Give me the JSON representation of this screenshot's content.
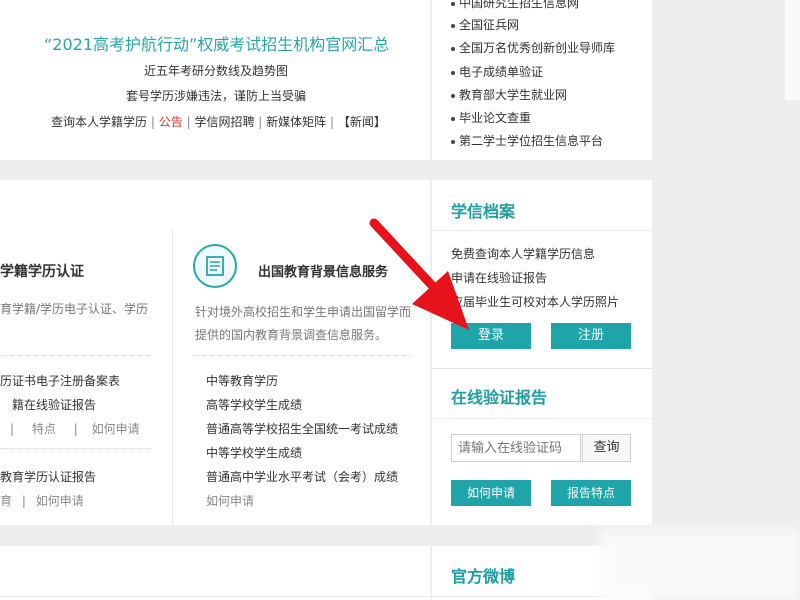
{
  "top": {
    "banner": "“2021高考护航行动”权威考试招生机构官网汇总",
    "line2": "近五年考研分数线及趋势图",
    "line3": "套号学历涉嫌违法，谨防上当受骗",
    "links": {
      "l1": "查询本人学籍学历",
      "sep": "|",
      "l2": "公告",
      "l3": "学信网招聘",
      "l4": "新媒体矩阵",
      "l5": "【新闻】"
    }
  },
  "right_list": [
    "中国研究生招生信息网",
    "全国征兵网",
    "全国万名优秀创新创业导师库",
    "电子成绩单验证",
    "教育部大学生就业网",
    "毕业论文查重",
    "第二学士学位招生信息平台"
  ],
  "card_left": {
    "title": "学籍学历认证",
    "desc": "育学籍/学历电子认证、学历",
    "item1": "历证书电子注册备案表",
    "item2": "籍在线验证报告",
    "sub1": {
      "a": "|",
      "b": "特点",
      "c": "|",
      "d": "如何申请"
    },
    "item3": "教育学历认证报告",
    "sub2": {
      "a": "育",
      "b": "|",
      "c": "如何申请"
    }
  },
  "card_mid": {
    "title": "出国教育背景信息服务",
    "desc1": "针对境外高校招生和学生申请出国留学而",
    "desc2": "提供的国内教育背景调查信息服务。",
    "items": [
      "中等教育学历",
      "高等学校学生成绩",
      "普通高等学校招生全国统一考试成绩",
      "中等学校学生成绩",
      "普通高中学业水平考试（会考）成绩"
    ],
    "how": "如何申请"
  },
  "xuexin": {
    "title": "学信档案",
    "lines": [
      "免费查询本人学籍学历信息",
      "申请在线验证报告",
      "应届毕业生可校对本人学历照片"
    ],
    "login": "登录",
    "register": "注册"
  },
  "verify": {
    "title": "在线验证报告",
    "placeholder": "请输入在线验证码",
    "query": "查询",
    "how": "如何申请",
    "features": "报告特点"
  },
  "weibo": {
    "title": "官方微博"
  },
  "colors": {
    "accent": "#1fa4a9",
    "arrow": "#e8121a",
    "announce": "#d9332b"
  },
  "icons": {
    "certificate": "certificate-icon",
    "arrow": "red-arrow"
  }
}
